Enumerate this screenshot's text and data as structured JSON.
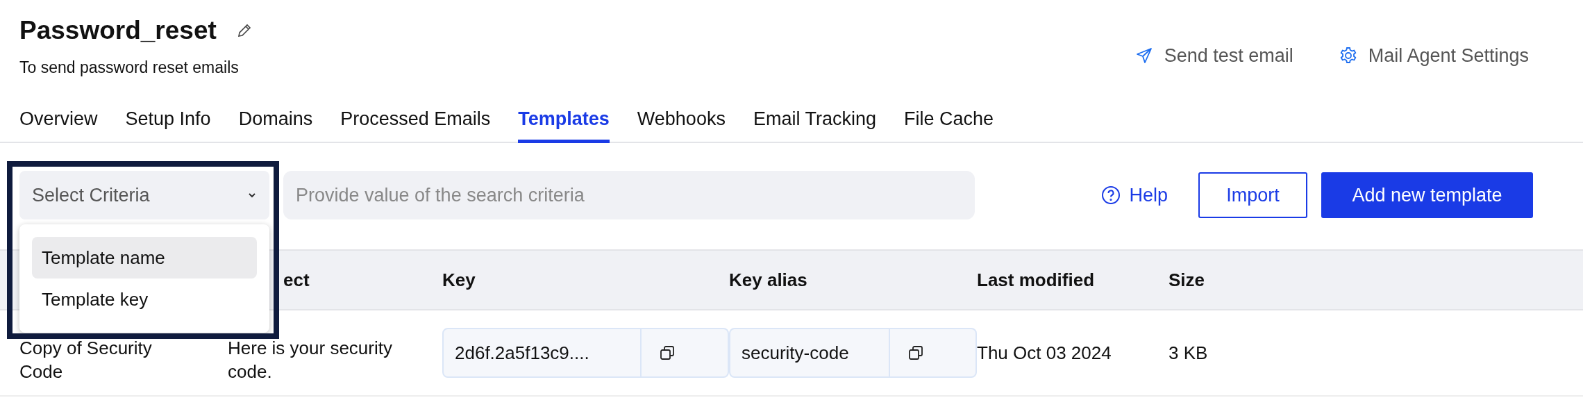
{
  "header": {
    "title": "Password_reset",
    "description": "To send password reset emails",
    "actions": [
      {
        "kind": "send",
        "label": "Send test email"
      },
      {
        "kind": "settings",
        "label": "Mail Agent Settings"
      }
    ]
  },
  "tabs": [
    {
      "label": "Overview",
      "selected": false
    },
    {
      "label": "Setup Info",
      "selected": false
    },
    {
      "label": "Domains",
      "selected": false
    },
    {
      "label": "Processed Emails",
      "selected": false
    },
    {
      "label": "Templates",
      "selected": true
    },
    {
      "label": "Webhooks",
      "selected": false
    },
    {
      "label": "Email Tracking",
      "selected": false
    },
    {
      "label": "File Cache",
      "selected": false
    }
  ],
  "toolbar": {
    "criteria_select": {
      "value": "Select Criteria",
      "expanded": true,
      "options": [
        {
          "label": "Template name",
          "selected": true
        },
        {
          "label": "Template key",
          "selected": false
        }
      ]
    },
    "search": {
      "placeholder": "Provide value of the search criteria"
    },
    "help": "Help",
    "import": "Import",
    "add": "Add new template"
  },
  "table": {
    "columns": [
      "ect",
      "Key",
      "Key alias",
      "Last modified",
      "Size"
    ],
    "rows": [
      {
        "name": "Copy of Security Code",
        "subject": "Here is your security code.",
        "key": "2d6f.2a5f13c9....",
        "key_alias": "security-code",
        "last_modified": "Thu Oct 03 2024",
        "size": "3 KB"
      }
    ]
  }
}
